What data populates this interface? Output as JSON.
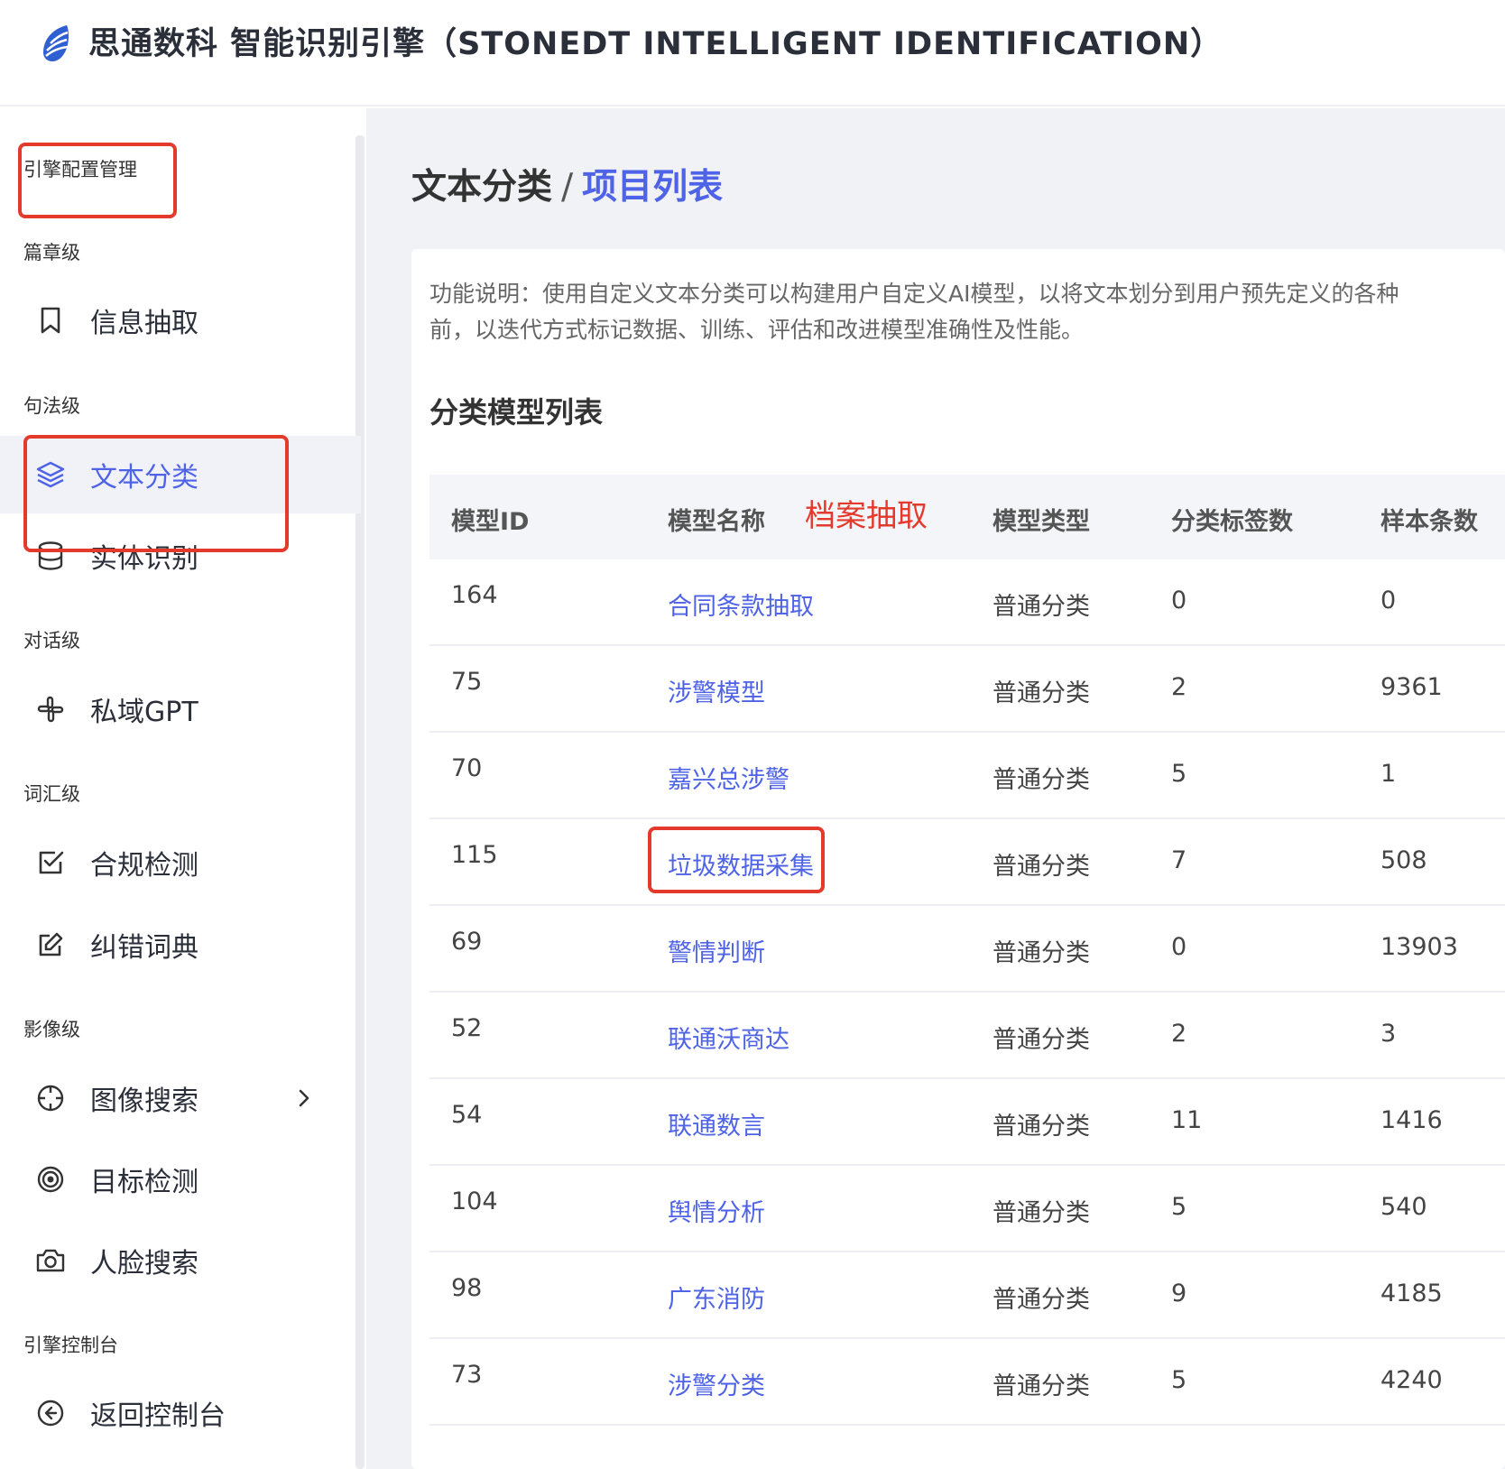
{
  "header": {
    "title": "思通数科 智能识别引擎（STONEDT INTELLIGENT IDENTIFICATION）"
  },
  "sidebar": {
    "top_section": "引擎配置管理",
    "groups": [
      {
        "title": "篇章级",
        "items": [
          {
            "label": "信息抽取",
            "icon": "bookmark-icon"
          }
        ]
      },
      {
        "title": "句法级",
        "items": [
          {
            "label": "文本分类",
            "icon": "layers-icon",
            "active": true
          },
          {
            "label": "实体识别",
            "icon": "database-icon"
          }
        ]
      },
      {
        "title": "对话级",
        "items": [
          {
            "label": "私域GPT",
            "icon": "slack-icon"
          }
        ]
      },
      {
        "title": "词汇级",
        "items": [
          {
            "label": "合规检测",
            "icon": "check-square-icon"
          },
          {
            "label": "纠错词典",
            "icon": "edit-icon"
          }
        ]
      },
      {
        "title": "影像级",
        "items": [
          {
            "label": "图像搜索",
            "icon": "crosshair-icon",
            "has_submenu": true
          },
          {
            "label": "目标检测",
            "icon": "target-icon"
          },
          {
            "label": "人脸搜索",
            "icon": "camera-icon"
          }
        ]
      },
      {
        "title": "引擎控制台",
        "items": [
          {
            "label": "返回控制台",
            "icon": "arrow-left-circle-icon"
          }
        ]
      }
    ]
  },
  "breadcrumb": {
    "parent": "文本分类",
    "separator": "/",
    "current": "项目列表"
  },
  "card": {
    "description_line1": "功能说明：使用自定义文本分类可以构建用户自定义AI模型，以将文本划分到用户预先定义的各种",
    "description_line2": "前，以迭代方式标记数据、训练、评估和改进模型准确性及性能。",
    "section_title": "分类模型列表"
  },
  "table": {
    "headers": [
      "模型ID",
      "模型名称",
      "模型类型",
      "分类标签数",
      "样本条数"
    ],
    "rows": [
      {
        "id": "164",
        "name": "合同条款抽取",
        "type": "普通分类",
        "labels": "0",
        "samples": "0"
      },
      {
        "id": "75",
        "name": "涉警模型",
        "type": "普通分类",
        "labels": "2",
        "samples": "9361"
      },
      {
        "id": "70",
        "name": "嘉兴总涉警",
        "type": "普通分类",
        "labels": "5",
        "samples": "1"
      },
      {
        "id": "115",
        "name": "垃圾数据采集",
        "type": "普通分类",
        "labels": "7",
        "samples": "508"
      },
      {
        "id": "69",
        "name": "警情判断",
        "type": "普通分类",
        "labels": "0",
        "samples": "13903"
      },
      {
        "id": "52",
        "name": "联通沃商达",
        "type": "普通分类",
        "labels": "2",
        "samples": "3"
      },
      {
        "id": "54",
        "name": "联通数言",
        "type": "普通分类",
        "labels": "11",
        "samples": "1416"
      },
      {
        "id": "104",
        "name": "舆情分析",
        "type": "普通分类",
        "labels": "5",
        "samples": "540"
      },
      {
        "id": "98",
        "name": "广东消防",
        "type": "普通分类",
        "labels": "9",
        "samples": "4185"
      },
      {
        "id": "73",
        "name": "涉警分类",
        "type": "普通分类",
        "labels": "5",
        "samples": "4240"
      }
    ]
  },
  "annotation": {
    "text": "档案抽取",
    "color": "#e33a2c"
  },
  "colors": {
    "accent": "#4e63e6",
    "annotation": "#e33a2c",
    "main_bg": "#f1f2f6"
  }
}
